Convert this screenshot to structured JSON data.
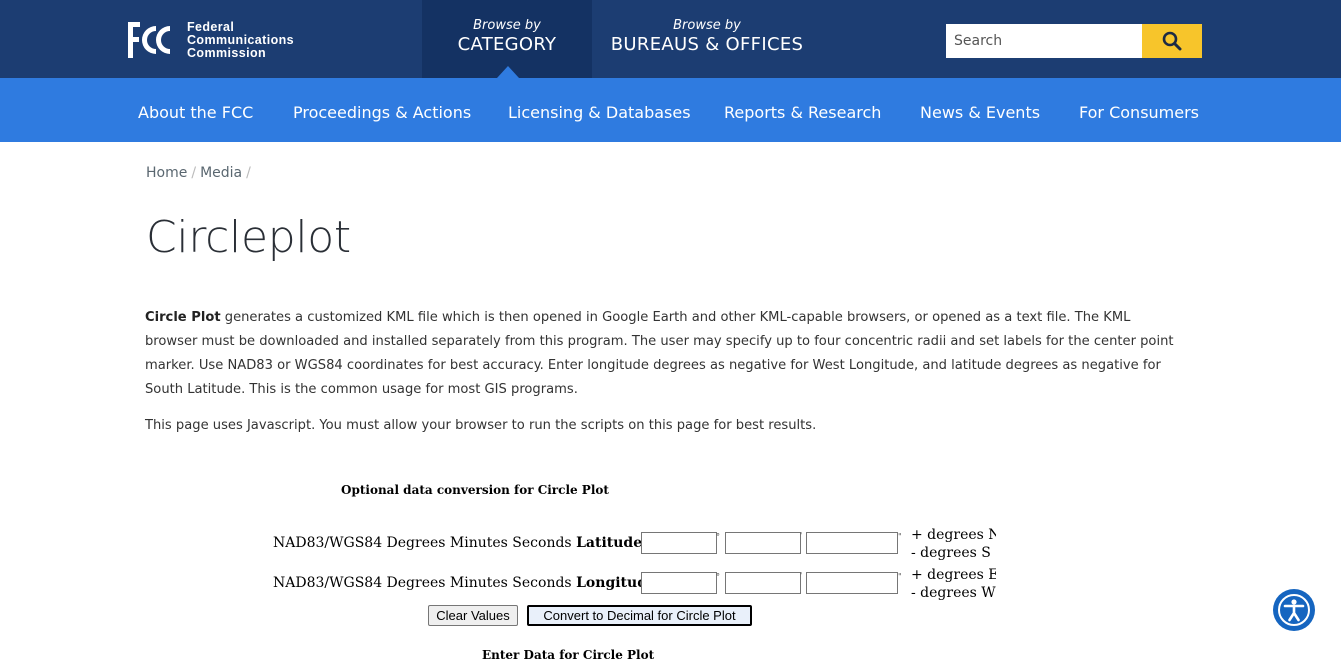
{
  "header": {
    "logo_lines": [
      "Federal",
      "Communications",
      "Commission"
    ],
    "browse_category": {
      "small": "Browse by",
      "big": "CATEGORY"
    },
    "browse_bureaus": {
      "small": "Browse by",
      "big": "BUREAUS & OFFICES"
    },
    "search_placeholder": "Search"
  },
  "nav": [
    "About the FCC",
    "Proceedings & Actions",
    "Licensing & Databases",
    "Reports & Research",
    "News & Events",
    "For Consumers"
  ],
  "breadcrumb": [
    "Home",
    "Media"
  ],
  "page_title": "Circleplot",
  "intro": {
    "bold": "Circle Plot",
    "text": " generates a customized KML file which is then opened in Google Earth and other KML-capable browsers, or opened as a text file.  The KML browser must be downloaded and installed separately from this program.  The user may specify up to four concentric radii and set labels for the center point marker.   Use NAD83 or WGS84 coordinates for best accuracy.  Enter longitude degrees as negative for West Longitude, and latitude degrees as negative for South Latitude.  This is the common usage for most GIS programs."
  },
  "js_note": "This page uses Javascript. You must allow your browser to run the scripts on this page for best results.",
  "form": {
    "title": "Optional data conversion for Circle Plot",
    "lat": {
      "prefix": "NAD83/WGS84 Degrees Minutes Seconds ",
      "bold": "Latitude",
      "suffix": ":",
      "dir_pos": "+ degrees N Latitude",
      "dir_neg": "-  degrees S Latitude"
    },
    "lon": {
      "prefix": "NAD83/WGS84 Degrees Minutes Seconds ",
      "bold": "Longitude",
      "suffix": ":",
      "dir_pos": "+ degrees E Longitude",
      "dir_neg": "-  degrees W Longitude"
    },
    "unit_deg": "°",
    "unit_min": "'",
    "unit_sec": "\"",
    "clear_label": "Clear Values",
    "convert_label": "Convert to Decimal for Circle Plot",
    "next_section_title": "Enter Data for Circle Plot"
  }
}
